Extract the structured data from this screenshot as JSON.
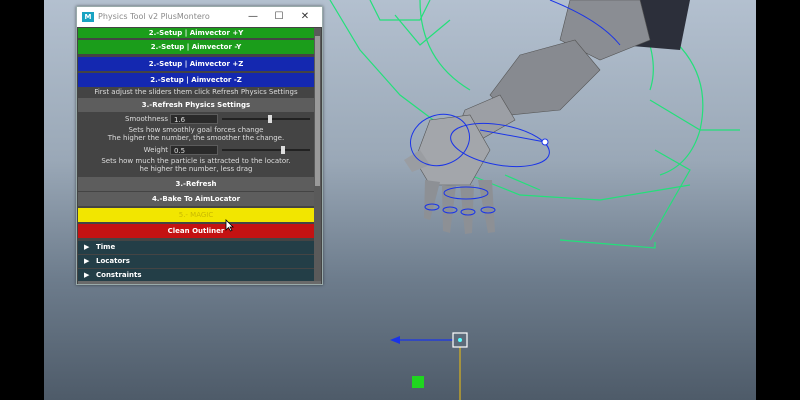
{
  "window": {
    "title": "Physics Tool v2 PlusMontero",
    "app_icon": "M",
    "minimize": "—",
    "maximize": "☐",
    "close": "✕"
  },
  "tool": {
    "setup_buttons": [
      {
        "label": "2.-Setup | Aimvector +Y",
        "color": "#1b9d1b"
      },
      {
        "label": "2.-Setup | Aimvector -Y",
        "color": "#1b9d1b"
      },
      {
        "label": "2.-Setup | Aimvector +Z",
        "color": "#1428b0"
      },
      {
        "label": "2.-Setup | Aimvector -Z",
        "color": "#1428b0"
      }
    ],
    "instruction": "First adjust the sliders them click Refresh Physics Settings",
    "refresh_settings_label": "3.-Refresh Physics Settings",
    "smoothness": {
      "label": "Smoothness",
      "value": "1.6",
      "fraction": 0.55,
      "desc_line1": "Sets how smoothly goal forces change",
      "desc_line2": "The higher the number, the smoother the change."
    },
    "weight": {
      "label": "Weight",
      "value": "0.5",
      "fraction": 0.7,
      "desc_line1": "Sets how much the particle is attracted to the locator.",
      "desc_line2": "he higher the number, less drag"
    },
    "refresh_label": "3.-Refresh",
    "bake_label": "4.-Bake To AimLocator",
    "magic_label": "5.- MAGIC",
    "magic_color": "#f2e600",
    "clean_label": "Clean Outliner",
    "clean_color": "#c41212",
    "frames": [
      {
        "label": "Time"
      },
      {
        "label": "Locators"
      },
      {
        "label": "Constraints"
      }
    ]
  },
  "scene": {
    "accent_green": "#23e07a",
    "accent_blue": "#1a34e8",
    "locator_yellow": "#d9b21c"
  }
}
